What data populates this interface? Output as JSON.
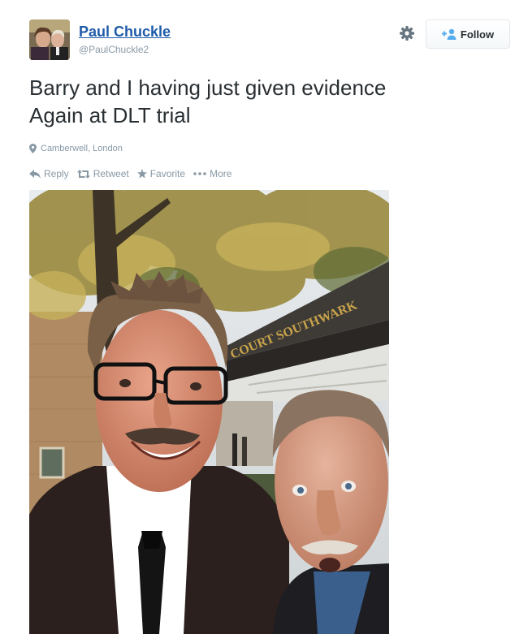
{
  "user": {
    "name": "Paul Chuckle",
    "handle": "@PaulChuckle2"
  },
  "follow_button": {
    "label": "Follow"
  },
  "tweet": {
    "lines": [
      "Barry and I having just given evidence",
      "Again at DLT trial"
    ],
    "location": "Camberwell, London"
  },
  "actions": {
    "reply": "Reply",
    "retweet": "Retweet",
    "favorite": "Favorite",
    "more": "More"
  },
  "photo": {
    "sign_text": "COURT SOUTHWARK"
  },
  "icons": [
    "gear-icon",
    "add-user-icon",
    "location-pin-icon",
    "reply-icon",
    "retweet-icon",
    "star-icon",
    "more-dots-icon"
  ],
  "colors": {
    "name_link": "#1e5ba8",
    "muted": "#8899a6",
    "text": "#292f33"
  }
}
